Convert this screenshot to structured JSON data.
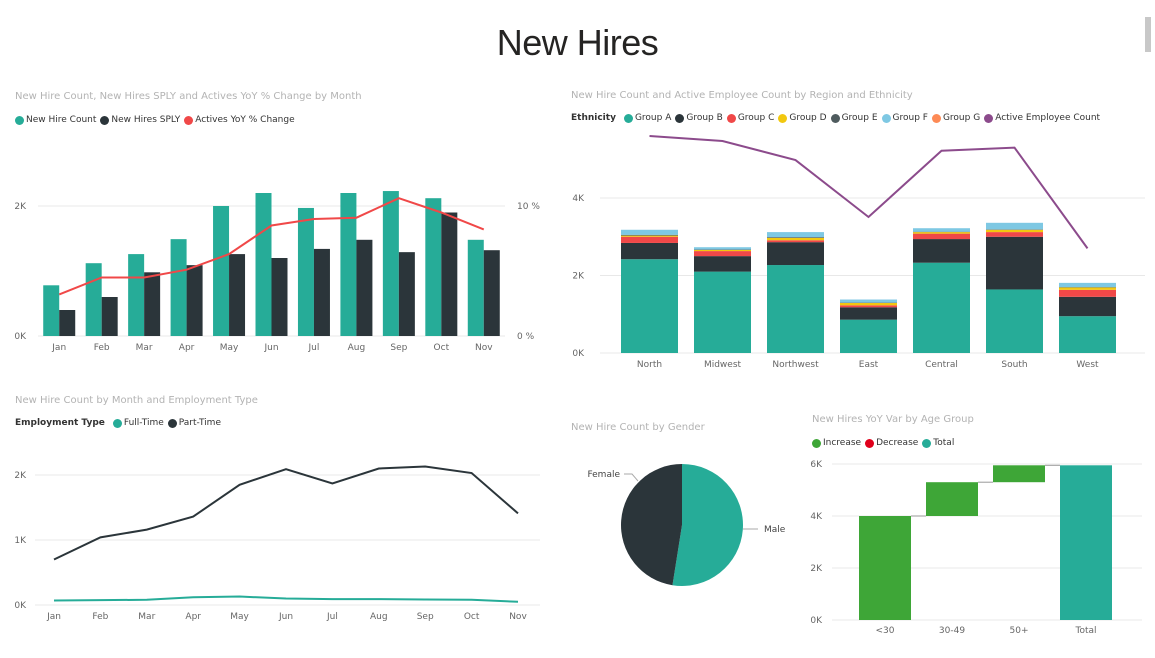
{
  "page": {
    "title": "New Hires"
  },
  "chart_data": [
    {
      "id": "monthly_combo",
      "type": "bar",
      "title": "New Hire Count, New Hires SPLY and Actives YoY % Change by Month",
      "categories": [
        "Jan",
        "Feb",
        "Mar",
        "Apr",
        "May",
        "Jun",
        "Jul",
        "Aug",
        "Sep",
        "Oct",
        "Nov"
      ],
      "series": [
        {
          "name": "New Hire Count",
          "kind": "bar",
          "axis": "left",
          "color": "#26ac98",
          "values": [
            780,
            1120,
            1260,
            1490,
            2000,
            2200,
            1970,
            2200,
            2230,
            2120,
            1480
          ]
        },
        {
          "name": "New Hires SPLY",
          "kind": "bar",
          "axis": "left",
          "color": "#2b353a",
          "values": [
            400,
            600,
            980,
            1090,
            1260,
            1200,
            1340,
            1480,
            1290,
            1900,
            1320
          ]
        },
        {
          "name": "Actives YoY % Change",
          "kind": "line",
          "axis": "right",
          "color": "#f04848",
          "values": [
            3.2,
            4.5,
            4.5,
            5.1,
            6.3,
            8.5,
            9.0,
            9.1,
            10.6,
            9.5,
            8.2
          ]
        }
      ],
      "y_left": {
        "ticks": [
          0,
          2000
        ],
        "tick_labels": [
          "0K",
          "2K"
        ],
        "range": [
          0,
          2000
        ]
      },
      "y_right": {
        "ticks": [
          0,
          10
        ],
        "tick_labels": [
          "0 %",
          "10 %"
        ],
        "range": [
          0,
          10
        ]
      },
      "xlabel": "",
      "ylabel": "",
      "grid": true,
      "legend": "top-left"
    },
    {
      "id": "region_stacked",
      "type": "bar",
      "stacked": true,
      "title": "New Hire Count and Active Employee Count by Region and Ethnicity",
      "legend_title": "Ethnicity",
      "categories": [
        "North",
        "Midwest",
        "Northwest",
        "East",
        "Central",
        "South",
        "West"
      ],
      "series": [
        {
          "name": "Group A",
          "color": "#26ac98",
          "values": [
            2420,
            2100,
            2270,
            860,
            2330,
            1640,
            950
          ]
        },
        {
          "name": "Group B",
          "color": "#2b353a",
          "values": [
            420,
            400,
            590,
            320,
            610,
            1360,
            500
          ]
        },
        {
          "name": "Group C",
          "color": "#f04848",
          "values": [
            160,
            130,
            50,
            50,
            140,
            120,
            180
          ]
        },
        {
          "name": "Group D",
          "color": "#f2c80f",
          "values": [
            30,
            30,
            60,
            60,
            40,
            60,
            60
          ]
        },
        {
          "name": "Group E",
          "color": "#4f5b5e",
          "values": [
            20,
            10,
            20,
            10,
            10,
            10,
            10
          ]
        },
        {
          "name": "Group F",
          "color": "#7ec8e3",
          "values": [
            130,
            60,
            130,
            80,
            90,
            170,
            110
          ]
        },
        {
          "name": "Group G",
          "color": "#fd8a55",
          "values": [
            0,
            0,
            0,
            0,
            0,
            0,
            0
          ]
        }
      ],
      "line_series": {
        "name": "Active Employee Count",
        "color": "#8c4b8c",
        "values": [
          5600,
          5470,
          4980,
          3510,
          5220,
          5300,
          2700
        ]
      },
      "y_left": {
        "ticks": [
          0,
          2000,
          4000
        ],
        "tick_labels": [
          "0K",
          "2K",
          "4K"
        ],
        "range": [
          0,
          5500
        ]
      },
      "grid": true,
      "legend": "top-left"
    },
    {
      "id": "employment_type_line",
      "type": "line",
      "title": "New Hire Count by Month and Employment Type",
      "legend_title": "Employment Type",
      "categories": [
        "Jan",
        "Feb",
        "Mar",
        "Apr",
        "May",
        "Jun",
        "Jul",
        "Aug",
        "Sep",
        "Oct",
        "Nov"
      ],
      "series": [
        {
          "name": "Full-Time",
          "color": "#26ac98",
          "values": [
            70,
            75,
            80,
            120,
            130,
            100,
            90,
            90,
            85,
            80,
            50
          ]
        },
        {
          "name": "Part-Time",
          "color": "#2b353a",
          "values": [
            700,
            1040,
            1160,
            1360,
            1850,
            2090,
            1870,
            2100,
            2130,
            2030,
            1410
          ]
        }
      ],
      "y_left": {
        "ticks": [
          0,
          1000,
          2000
        ],
        "tick_labels": [
          "0K",
          "1K",
          "2K"
        ],
        "range": [
          0,
          2000
        ]
      },
      "grid": true,
      "legend": "top-left"
    },
    {
      "id": "gender_pie",
      "type": "pie",
      "title": "New Hire Count by Gender",
      "slices": [
        {
          "name": "Male",
          "value": 52.5,
          "color": "#26ac98"
        },
        {
          "name": "Female",
          "value": 47.5,
          "color": "#2b353a"
        }
      ],
      "legend": "none"
    },
    {
      "id": "age_waterfall",
      "type": "bar",
      "subtype": "waterfall",
      "title": "New Hires YoY Var by Age Group",
      "legend_items": [
        {
          "name": "Increase",
          "color": "#3ea637"
        },
        {
          "name": "Decrease",
          "color": "#e0001b"
        },
        {
          "name": "Total",
          "color": "#26ac98"
        }
      ],
      "categories": [
        "<30",
        "30-49",
        "50+",
        "Total"
      ],
      "values": [
        4000,
        1300,
        650,
        5950
      ],
      "kinds": [
        "increase",
        "increase",
        "increase",
        "total"
      ],
      "y_left": {
        "ticks": [
          0,
          2000,
          4000,
          6000
        ],
        "tick_labels": [
          "0K",
          "2K",
          "4K",
          "6K"
        ],
        "range": [
          0,
          6000
        ]
      },
      "grid": true,
      "legend": "top-left"
    }
  ]
}
